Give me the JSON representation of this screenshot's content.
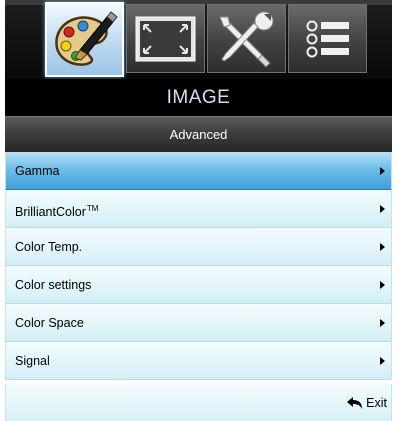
{
  "tabs": [
    {
      "icon": "palette-brush-icon",
      "active": true
    },
    {
      "icon": "display-frame-icon",
      "active": false
    },
    {
      "icon": "tools-icon",
      "active": false
    },
    {
      "icon": "list-menu-icon",
      "active": false
    }
  ],
  "menu": {
    "title": "IMAGE",
    "subtitle": "Advanced",
    "items": [
      {
        "label": "Gamma",
        "selected": true
      },
      {
        "label": "BrilliantColor",
        "trademark": "TM"
      },
      {
        "label": "Color Temp."
      },
      {
        "label": "Color settings"
      },
      {
        "label": "Color Space"
      },
      {
        "label": "Signal"
      }
    ],
    "exit_label": "Exit"
  },
  "colors": {
    "selected_highlight": "#4ea9df",
    "row_background": "#e3f5fa",
    "title_text": "#cfe2f3"
  }
}
